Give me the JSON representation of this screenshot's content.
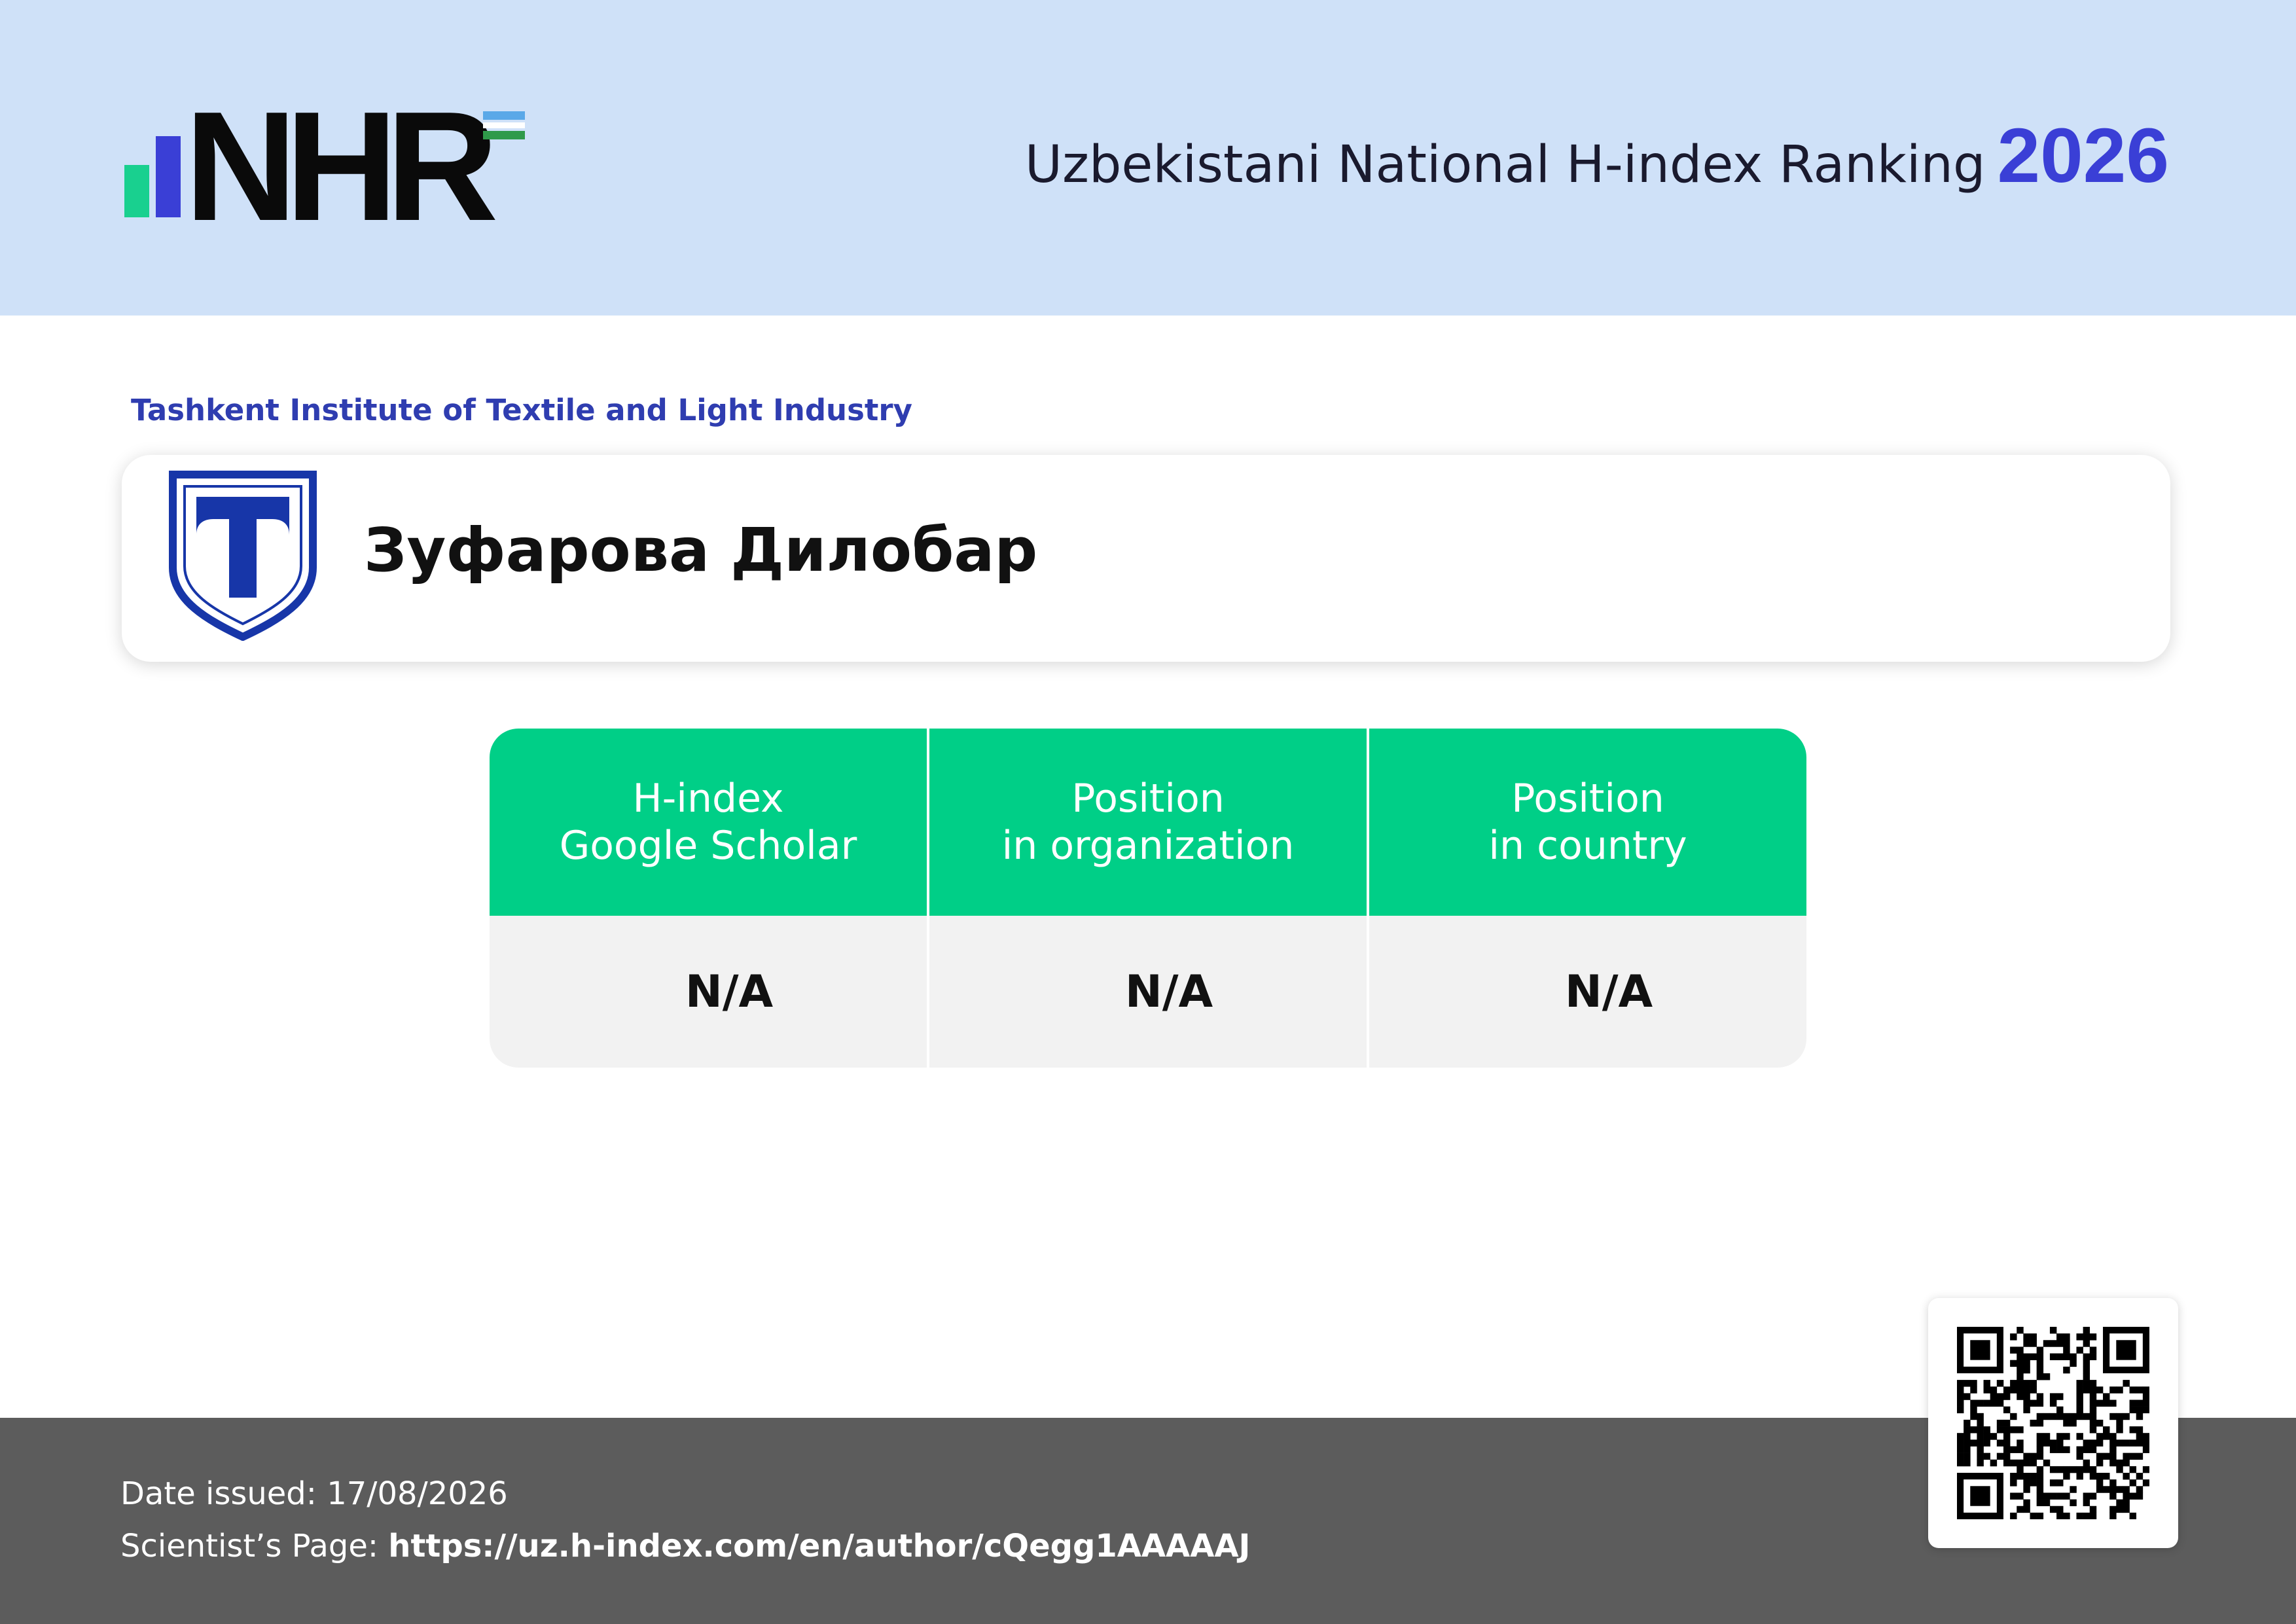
{
  "header": {
    "logo_text": "NHR",
    "title": "Uzbekistani National H-index Ranking",
    "year": "2026"
  },
  "organization": "Tashkent Institute of Textile and Light Industry",
  "scientist": {
    "name": "Зуфарова Дилобар"
  },
  "stats": [
    {
      "label_line1": "H-index",
      "label_line2": "Google Scholar",
      "value": "N/A"
    },
    {
      "label_line1": "Position",
      "label_line2": "in organization",
      "value": "N/A"
    },
    {
      "label_line1": "Position",
      "label_line2": "in country",
      "value": "N/A"
    }
  ],
  "footer": {
    "date_issued": "Date issued: 17/08/2026",
    "page_label": "Scientist’s Page:",
    "page_url": "https://uz.h-index.com/en/author/cQegg1AAAAAJ"
  },
  "colors": {
    "header_bg": "#cfe1f8",
    "accent_blue": "#3a3fd6",
    "accent_green": "#00cf87",
    "footer_bg": "#5c5c5c"
  }
}
